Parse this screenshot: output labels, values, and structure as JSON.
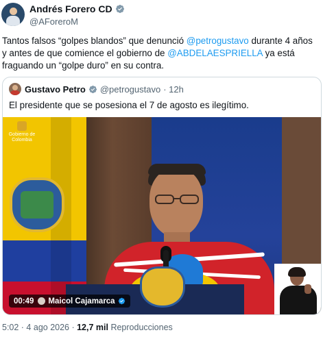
{
  "tweet": {
    "author": {
      "display_name": "Andrés Forero CD",
      "handle": "@AForeroM",
      "verified": true
    },
    "text_parts": [
      {
        "text": "Tantos falsos “golpes blandos” que denunció ",
        "type": "text"
      },
      {
        "text": "@petrogustavo",
        "type": "mention"
      },
      {
        "text": " durante 4 años y antes de que comience el gobierno de ",
        "type": "text"
      },
      {
        "text": "@ABDELAESPRIELLA",
        "type": "mention"
      },
      {
        "text": " ya está fraguando un “golpe duro” en su contra.",
        "type": "text"
      }
    ],
    "quoted": {
      "display_name": "Gustavo Petro",
      "handle": "@petrogustavo",
      "age": "· 12h",
      "verified": true,
      "text": "El presidente que se posesiona el 7 de agosto es ilegítimo.",
      "video": {
        "duration": "00:49",
        "uploader": "Maicol Cajamarca",
        "uploader_verified": true,
        "backdrop_text": "Gobierno de Colombia"
      }
    },
    "meta": {
      "timestamp": "5:02 · 4 ago 2026 · ",
      "views_count": "12,7 mil",
      "views_label": " Reproducciones"
    }
  },
  "colors": {
    "accent": "#1d9bf0",
    "text": "#0f1419",
    "secondary_text": "#536471",
    "border": "#cfd9de"
  }
}
